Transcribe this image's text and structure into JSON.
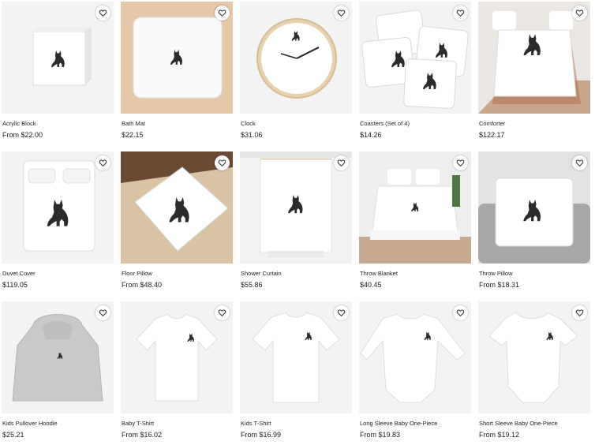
{
  "products": [
    {
      "name": "Acrylic Block",
      "price": "From $22.00",
      "icon": "heart-outline-icon"
    },
    {
      "name": "Bath Mat",
      "price": "$22.15",
      "icon": "heart-outline-icon"
    },
    {
      "name": "Clock",
      "price": "$31.06",
      "icon": "heart-outline-icon"
    },
    {
      "name": "Coasters (Set of 4)",
      "price": "$14.26",
      "icon": "heart-outline-icon"
    },
    {
      "name": "Comforter",
      "price": "$122.17",
      "icon": "heart-outline-icon"
    },
    {
      "name": "Duvet Cover",
      "price": "$119.05",
      "icon": "heart-outline-icon"
    },
    {
      "name": "Floor Pillow",
      "price": "From $48.40",
      "icon": "heart-outline-icon"
    },
    {
      "name": "Shower Curtain",
      "price": "$55.86",
      "icon": "heart-outline-icon"
    },
    {
      "name": "Throw Blanket",
      "price": "$40.45",
      "icon": "heart-outline-icon"
    },
    {
      "name": "Throw Pillow",
      "price": "From $18.31",
      "icon": "heart-outline-icon"
    },
    {
      "name": "Kids Pullover Hoodie",
      "price": "$25.21",
      "icon": "heart-outline-icon"
    },
    {
      "name": "Baby T-Shirt",
      "price": "From $16.02",
      "icon": "heart-outline-icon"
    },
    {
      "name": "Kids T-Shirt",
      "price": "From $16.99",
      "icon": "heart-outline-icon"
    },
    {
      "name": "Long Sleeve Baby One-Piece",
      "price": "From $19.83",
      "icon": "heart-outline-icon"
    },
    {
      "name": "Short Sleeve Baby One-Piece",
      "price": "From $19.12",
      "icon": "heart-outline-icon"
    }
  ]
}
